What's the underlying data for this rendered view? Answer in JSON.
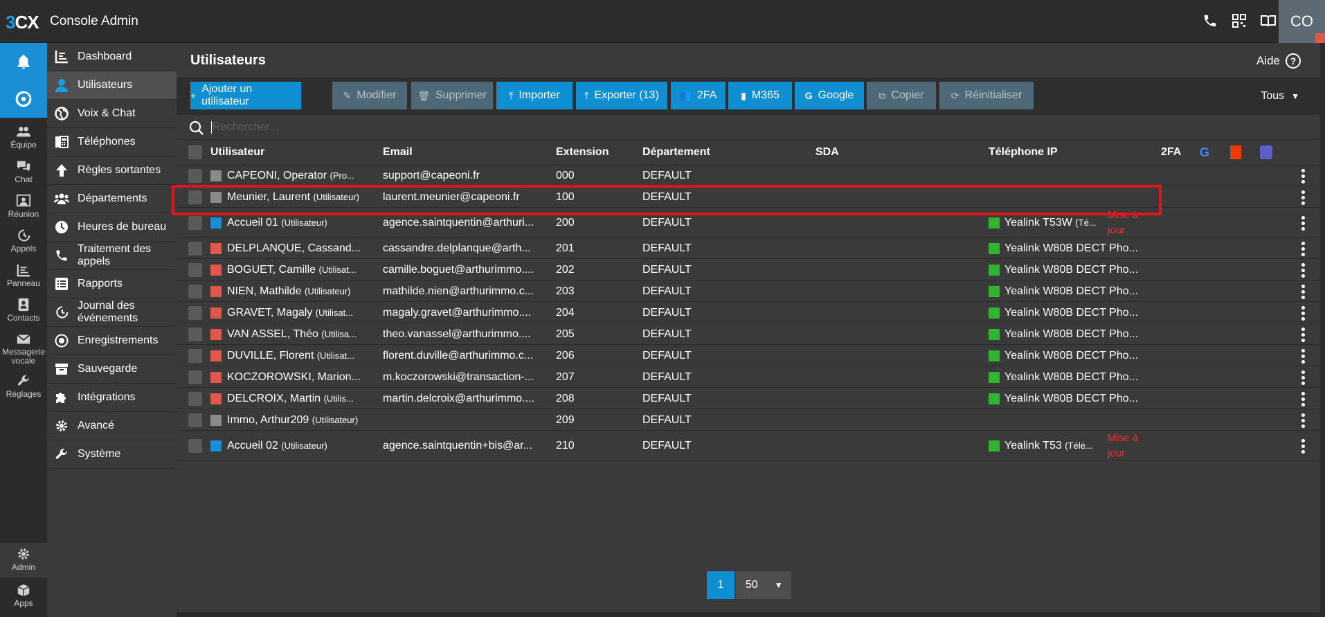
{
  "app": {
    "logo_a": "3",
    "logo_b": "CX",
    "title": "Console Admin",
    "user_initials": "CO"
  },
  "rail": [
    {
      "name": "notifications",
      "label": ""
    },
    {
      "name": "3cx",
      "label": ""
    },
    {
      "name": "equipe",
      "label": "Équipe"
    },
    {
      "name": "chat",
      "label": "Chat"
    },
    {
      "name": "reunion",
      "label": "Réunion"
    },
    {
      "name": "appels",
      "label": "Appels"
    },
    {
      "name": "panneau",
      "label": "Panneau"
    },
    {
      "name": "contacts",
      "label": "Contacts"
    },
    {
      "name": "messagerie",
      "label": "Messagerie vocale"
    },
    {
      "name": "reglages",
      "label": "Réglages"
    },
    {
      "name": "admin",
      "label": "Admin"
    },
    {
      "name": "apps",
      "label": "Apps"
    }
  ],
  "nav": [
    {
      "label": "Dashboard"
    },
    {
      "label": "Utilisateurs"
    },
    {
      "label": "Voix & Chat"
    },
    {
      "label": "Téléphones"
    },
    {
      "label": "Règles sortantes"
    },
    {
      "label": "Départements"
    },
    {
      "label": "Heures de bureau"
    },
    {
      "label": "Traitement des appels"
    },
    {
      "label": "Rapports"
    },
    {
      "label": "Journal des événements"
    },
    {
      "label": "Enregistrements"
    },
    {
      "label": "Sauvegarde"
    },
    {
      "label": "Intégrations"
    },
    {
      "label": "Avancé"
    },
    {
      "label": "Système"
    }
  ],
  "page": {
    "title": "Utilisateurs",
    "help": "Aide",
    "help_icon": "?"
  },
  "toolbar": {
    "add": "Ajouter un utilisateur",
    "edit": "Modifier",
    "delete": "Supprimer",
    "import": "Importer",
    "export": "Exporter (13)",
    "twofa": "2FA",
    "m365": "M365",
    "google": "Google",
    "copy": "Copier",
    "reset": "Réinitialiser",
    "filter": "Tous"
  },
  "search": {
    "placeholder": "Rechercher..."
  },
  "columns": {
    "user": "Utilisateur",
    "email": "Email",
    "ext": "Extension",
    "dept": "Département",
    "sda": "SDA",
    "phone": "Téléphone IP",
    "twofa": "2FA"
  },
  "rows": [
    {
      "name": "CAPEONI, Operator",
      "role": "(Pro...",
      "email": "support@capeoni.fr",
      "ext": "000",
      "dept": "DEFAULT",
      "phone": "",
      "phone_note": "",
      "update": "",
      "color": "#8a8a8a"
    },
    {
      "name": "Meunier, Laurent",
      "role": "(Utilisateur)",
      "email": "laurent.meunier@capeoni.fr",
      "ext": "100",
      "dept": "DEFAULT",
      "phone": "",
      "phone_note": "",
      "update": "",
      "color": "#8a8a8a"
    },
    {
      "name": "Accueil 01",
      "role": "(Utilisateur)",
      "email": "agence.saintquentin@arthuri...",
      "ext": "200",
      "dept": "DEFAULT",
      "phone": "Yealink T53W",
      "phone_note": "(Té...",
      "update": "Mise à jour",
      "color": "#1a8fd6"
    },
    {
      "name": "DELPLANQUE, Cassand...",
      "role": "",
      "email": "cassandre.delplanque@arth...",
      "ext": "201",
      "dept": "DEFAULT",
      "phone": "Yealink W80B DECT Pho...",
      "phone_note": "",
      "update": "",
      "color": "#e2574c"
    },
    {
      "name": "BOGUET, Camille",
      "role": "(Utilisat...",
      "email": "camille.boguet@arthurimmo....",
      "ext": "202",
      "dept": "DEFAULT",
      "phone": "Yealink W80B DECT Pho...",
      "phone_note": "",
      "update": "",
      "color": "#e2574c"
    },
    {
      "name": "NIEN, Mathilde",
      "role": "(Utilisateur)",
      "email": "mathilde.nien@arthurimmo.c...",
      "ext": "203",
      "dept": "DEFAULT",
      "phone": "Yealink W80B DECT Pho...",
      "phone_note": "",
      "update": "",
      "color": "#e2574c"
    },
    {
      "name": "GRAVET, Magaly",
      "role": "(Utilisat...",
      "email": "magaly.gravet@arthurimmo....",
      "ext": "204",
      "dept": "DEFAULT",
      "phone": "Yealink W80B DECT Pho...",
      "phone_note": "",
      "update": "",
      "color": "#e2574c"
    },
    {
      "name": "VAN ASSEL, Théo",
      "role": "(Utilisa...",
      "email": "theo.vanassel@arthurimmo....",
      "ext": "205",
      "dept": "DEFAULT",
      "phone": "Yealink W80B DECT Pho...",
      "phone_note": "",
      "update": "",
      "color": "#e2574c"
    },
    {
      "name": "DUVILLE, Florent",
      "role": "(Utilisat...",
      "email": "florent.duville@arthurimmo.c...",
      "ext": "206",
      "dept": "DEFAULT",
      "phone": "Yealink W80B DECT Pho...",
      "phone_note": "",
      "update": "",
      "color": "#e2574c"
    },
    {
      "name": "KOCZOROWSKI, Marion...",
      "role": "",
      "email": "m.koczorowski@transaction-...",
      "ext": "207",
      "dept": "DEFAULT",
      "phone": "Yealink W80B DECT Pho...",
      "phone_note": "",
      "update": "",
      "color": "#e2574c"
    },
    {
      "name": "DELCROIX, Martin",
      "role": "(Utilis...",
      "email": "martin.delcroix@arthurimmo....",
      "ext": "208",
      "dept": "DEFAULT",
      "phone": "Yealink W80B DECT Pho...",
      "phone_note": "",
      "update": "",
      "color": "#e2574c"
    },
    {
      "name": "Immo, Arthur209",
      "role": "(Utilisateur)",
      "email": "",
      "ext": "209",
      "dept": "DEFAULT",
      "phone": "",
      "phone_note": "",
      "update": "",
      "color": "#8a8a8a"
    },
    {
      "name": "Accueil 02",
      "role": "(Utilisateur)",
      "email": "agence.saintquentin+bis@ar...",
      "ext": "210",
      "dept": "DEFAULT",
      "phone": "Yealink T53",
      "phone_note": "(Télé...",
      "update": "Mise à jour",
      "color": "#1a8fd6"
    }
  ],
  "pager": {
    "page": "1",
    "size": "50"
  },
  "colors": {
    "accent": "#0f8fd2",
    "online": "#2fb52f",
    "alert": "#e2141c"
  }
}
